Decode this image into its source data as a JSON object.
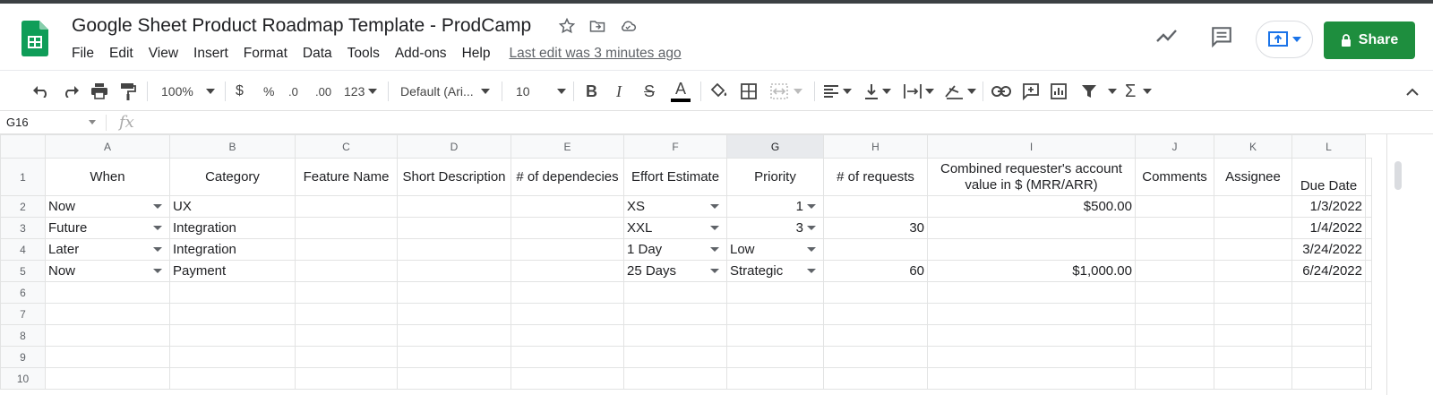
{
  "app": {
    "title": "Google Sheet Product Roadmap Template - ProdCamp",
    "menu": [
      "File",
      "Edit",
      "View",
      "Insert",
      "Format",
      "Data",
      "Tools",
      "Add-ons",
      "Help"
    ],
    "last_edit": "Last edit was 3 minutes ago",
    "share_label": "Share",
    "brand_color": "#1e8e3e"
  },
  "toolbar": {
    "zoom": "100%",
    "currency": "$",
    "percent": "%",
    "dec_decrease": ".0",
    "dec_increase": ".00",
    "more_formats": "123",
    "font": "Default (Ari...",
    "font_size": "10",
    "bold": "B",
    "italic": "I",
    "strike": "S",
    "textcolor": "A"
  },
  "formula_bar": {
    "cell_ref": "G16",
    "fx": "fx",
    "value": ""
  },
  "sheet": {
    "columns": [
      "A",
      "B",
      "C",
      "D",
      "E",
      "F",
      "G",
      "H",
      "I",
      "J",
      "K",
      "L"
    ],
    "selected_column": "G",
    "row_numbers": [
      "1",
      "2",
      "3",
      "4",
      "5",
      "6",
      "7",
      "8",
      "9",
      "10"
    ],
    "header_row": [
      "When",
      "Category",
      "Feature Name",
      "Short Description",
      "# of dependecies",
      "Effort Estimate",
      "Priority",
      "# of requests",
      "Combined requester's account value in $ (MRR/ARR)",
      "Comments",
      "Assignee",
      "Due Date"
    ],
    "rows": [
      [
        "Now",
        "UX",
        "",
        "",
        "",
        "XS",
        "1",
        "",
        "$500.00",
        "",
        "",
        "1/3/2022"
      ],
      [
        "Future",
        "Integration",
        "",
        "",
        "",
        "XXL",
        "3",
        "30",
        "",
        "",
        "",
        "1/4/2022"
      ],
      [
        "Later",
        "Integration",
        "",
        "",
        "",
        "1 Day",
        "Low",
        "",
        "",
        "",
        "",
        "3/24/2022"
      ],
      [
        "Now",
        "Payment",
        "",
        "",
        "",
        "25 Days",
        "Strategic",
        "60",
        "$1,000.00",
        "",
        "",
        "6/24/2022"
      ],
      [
        "",
        "",
        "",
        "",
        "",
        "",
        "",
        "",
        "",
        "",
        "",
        ""
      ],
      [
        "",
        "",
        "",
        "",
        "",
        "",
        "",
        "",
        "",
        "",
        "",
        ""
      ],
      [
        "",
        "",
        "",
        "",
        "",
        "",
        "",
        "",
        "",
        "",
        "",
        ""
      ],
      [
        "",
        "",
        "",
        "",
        "",
        "",
        "",
        "",
        "",
        "",
        "",
        ""
      ],
      [
        "",
        "",
        "",
        "",
        "",
        "",
        "",
        "",
        "",
        "",
        "",
        ""
      ]
    ]
  }
}
